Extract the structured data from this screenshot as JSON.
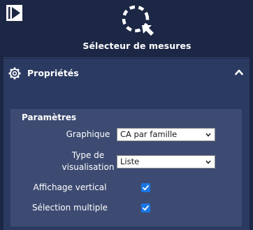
{
  "app": {
    "title": "Sélecteur de mesures"
  },
  "properties": {
    "title": "Propriétés"
  },
  "parameters": {
    "title": "Paramètres",
    "chart_label": "Graphique",
    "chart_value": "CA par famille",
    "viz_type_label_line1": "Type de",
    "viz_type_label_line2": "visualisation",
    "viz_type_value": "Liste",
    "vertical_display_label": "Affichage vertical",
    "vertical_display_checked": true,
    "multi_select_label": "Sélection multiple",
    "multi_select_checked": true
  },
  "icons": {
    "collapse": "collapse-panel-icon",
    "main": "dashed-circle-cursor-icon",
    "settings": "gear-icon",
    "expand": "chevron-up-icon",
    "dropdown": "chevron-down-icon",
    "checkbox": "checkmark-icon"
  },
  "colors": {
    "background": "#1c2745",
    "panel": "#2b3a61",
    "params_box": "#3d4b72",
    "checkbox_accent": "#1976e6"
  }
}
